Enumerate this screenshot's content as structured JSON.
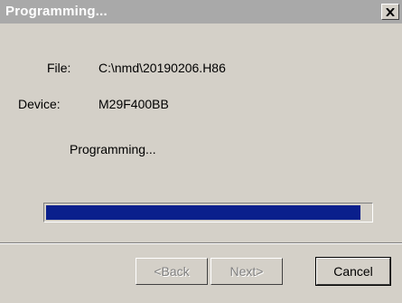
{
  "window": {
    "title": "Programming...",
    "close_symbol": "×"
  },
  "info": {
    "file_label": "File:",
    "file_value": "C:\\nmd\\20190206.H86",
    "device_label": "Device:",
    "device_value": "M29F400BB",
    "status_text": "Programming..."
  },
  "progress": {
    "fraction": 0.97
  },
  "buttons": {
    "back_label": "<Back",
    "next_label": "Next>",
    "cancel_label": "Cancel"
  },
  "colors": {
    "titlebar_inactive": "#a9a9a9",
    "dialog_face": "#d4d0c8",
    "progress_fill": "#0a1f8c"
  }
}
